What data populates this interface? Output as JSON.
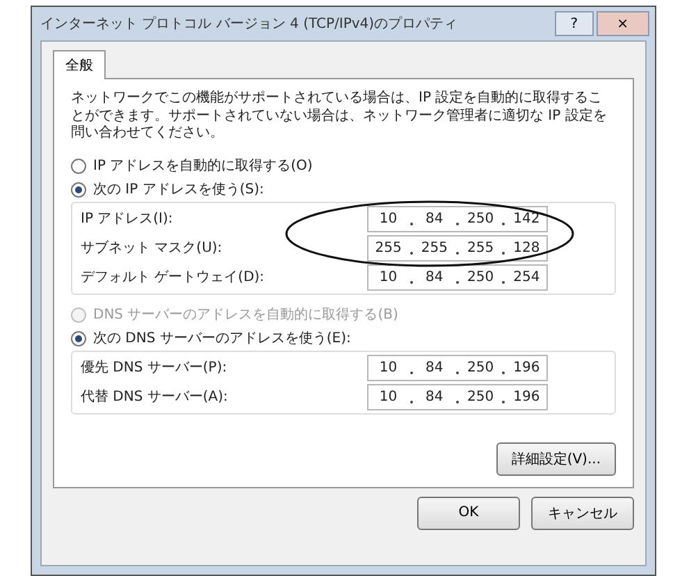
{
  "window": {
    "title": "インターネット プロトコル バージョン 4 (TCP/IPv4)のプロパティ",
    "title_buttons": [
      "?",
      "×"
    ]
  },
  "tabs": [
    {
      "label": "全般",
      "selected": true
    }
  ],
  "description": "ネットワークでこの機能がサポートされている場合は、IP 設定を自動的に取得することができます。サポートされていない場合は、ネットワーク管理者に適切な IP 設定を問い合わせてください。",
  "ip_group": {
    "options": [
      {
        "label": "IP アドレスを自動的に取得する(O)",
        "selected": false,
        "disabled": false
      },
      {
        "label": "次の IP アドレスを使う(S):",
        "selected": true,
        "disabled": false
      }
    ],
    "fields": [
      {
        "label": "IP アドレス(I):",
        "octets": [
          "10",
          "84",
          "250",
          "142"
        ]
      },
      {
        "label": "サブネット マスク(U):",
        "octets": [
          "255",
          "255",
          "255",
          "128"
        ]
      },
      {
        "label": "デフォルト ゲートウェイ(D):",
        "octets": [
          "10",
          "84",
          "250",
          "254"
        ]
      }
    ]
  },
  "dns_group": {
    "options": [
      {
        "label": "DNS サーバーのアドレスを自動的に取得する(B)",
        "selected": false,
        "disabled": true
      },
      {
        "label": "次の DNS サーバーのアドレスを使う(E):",
        "selected": true,
        "disabled": false
      }
    ],
    "fields": [
      {
        "label": "優先 DNS サーバー(P):",
        "octets": [
          "10",
          "84",
          "250",
          "196"
        ]
      },
      {
        "label": "代替 DNS サーバー(A):",
        "octets": [
          "10",
          "84",
          "250",
          "196"
        ]
      }
    ]
  },
  "advanced_button": "詳細設定(V)...",
  "buttons": [
    "OK",
    "キャンセル"
  ],
  "annotation": {
    "kind": "ellipse"
  }
}
